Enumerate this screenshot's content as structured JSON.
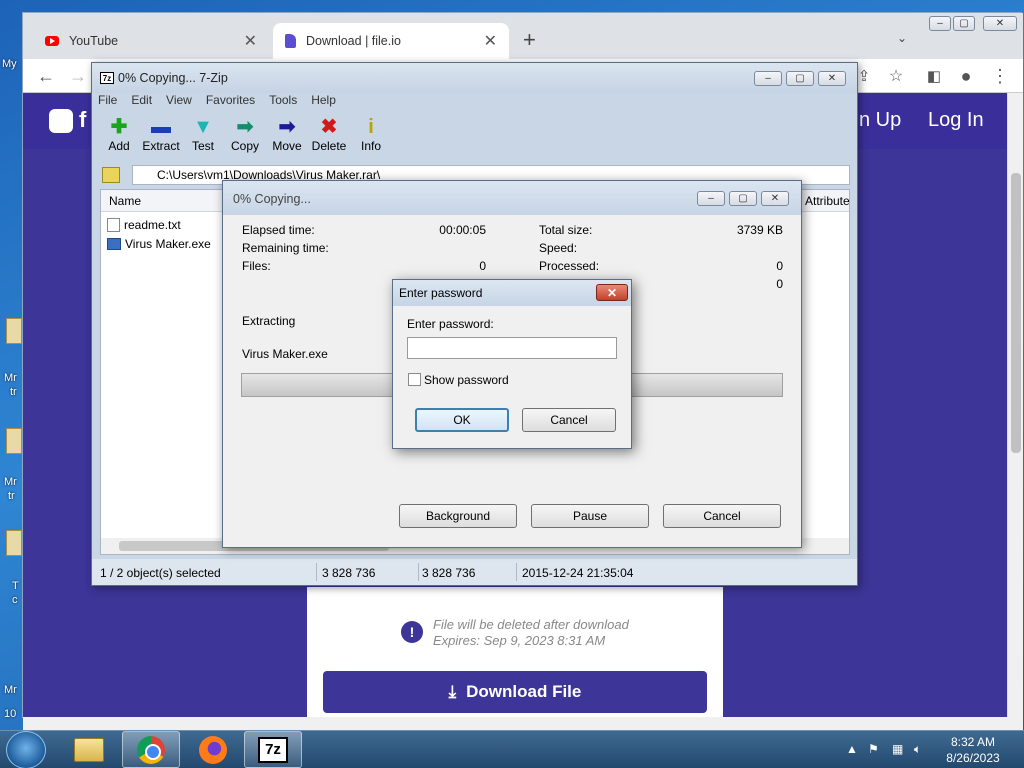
{
  "desktop": {
    "icon_labels": [
      "My",
      "Mr",
      "tr",
      "Mr",
      "tr",
      "T",
      "c",
      "Mr",
      "10"
    ]
  },
  "browser": {
    "tabs": [
      {
        "title": "YouTube",
        "icon": "youtube-icon"
      },
      {
        "title": "Download | file.io",
        "icon": "fileio-icon"
      }
    ],
    "new_tab_symbol": "+",
    "page": {
      "nav": [
        "n Up",
        "Log In"
      ],
      "logo_partial": "f",
      "notice_line1": "File will be deleted after download",
      "notice_line2": "Expires: Sep 9, 2023 8:31 AM",
      "download_button": "Download File"
    }
  },
  "zip": {
    "title": "0% Copying... 7-Zip",
    "menu": [
      "File",
      "Edit",
      "View",
      "Favorites",
      "Tools",
      "Help"
    ],
    "tools": [
      {
        "label": "Add",
        "glyph": "✚",
        "color": "#1aa51a"
      },
      {
        "label": "Extract",
        "glyph": "▬",
        "color": "#1a3fb5"
      },
      {
        "label": "Test",
        "glyph": "▼",
        "color": "#1ab5b5"
      },
      {
        "label": "Copy",
        "glyph": "➡",
        "color": "#1a8a6a"
      },
      {
        "label": "Move",
        "glyph": "➡",
        "color": "#1a1a9a"
      },
      {
        "label": "Delete",
        "glyph": "✖",
        "color": "#d01a1a"
      },
      {
        "label": "Info",
        "glyph": "i",
        "color": "#d6c21a"
      }
    ],
    "path": "C:\\Users\\vm1\\Downloads\\Virus Maker.rar\\",
    "columns": {
      "name": "Name",
      "attributes": "Attribute"
    },
    "files": [
      "readme.txt",
      "Virus Maker.exe"
    ],
    "status": {
      "selection": "1 / 2 object(s) selected",
      "size": "3 828 736",
      "packed": "3 828 736",
      "modified": "2015-12-24 21:35:04"
    }
  },
  "copy": {
    "title": "0% Copying...",
    "elapsed_label": "Elapsed time:",
    "elapsed_value": "00:00:05",
    "remaining_label": "Remaining time:",
    "files_label": "Files:",
    "files_value": "0",
    "total_label": "Total size:",
    "total_value": "3739 KB",
    "speed_label": "Speed:",
    "processed_label": "Processed:",
    "processed_value": "0",
    "extra_value": "0",
    "action": "Extracting",
    "current_file": "Virus Maker.exe",
    "progress": 0,
    "buttons": {
      "background": "Background",
      "pause": "Pause",
      "cancel": "Cancel"
    }
  },
  "password": {
    "title": "Enter password",
    "prompt": "Enter password:",
    "value": "",
    "show_label": "Show password",
    "ok": "OK",
    "cancel": "Cancel"
  },
  "taskbar": {
    "time": "8:32 AM",
    "date": "8/26/2023",
    "tray_arrow": "▲"
  }
}
